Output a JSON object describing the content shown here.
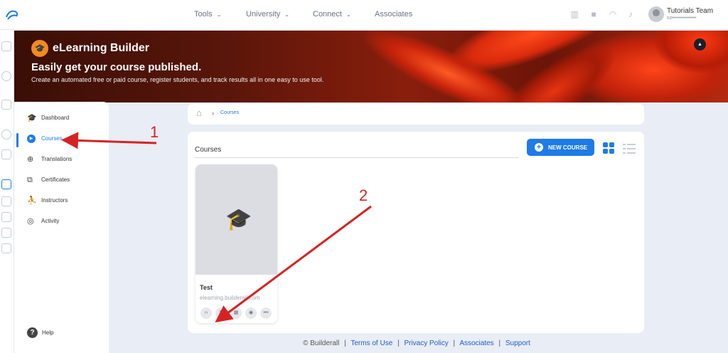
{
  "topbar": {
    "nav": [
      {
        "label": "Tools",
        "has_chevron": true
      },
      {
        "label": "University",
        "has_chevron": true
      },
      {
        "label": "Connect",
        "has_chevron": true
      },
      {
        "label": "Associates",
        "has_chevron": false
      }
    ],
    "icons": [
      "book-icon",
      "video-icon",
      "headset-icon",
      "bell-icon"
    ],
    "user": {
      "name": "Tutorials Team",
      "email_masked": "tut••••••••••••••••"
    }
  },
  "banner": {
    "brand_name": "eLearning Builder",
    "headline": "Easily get your course published.",
    "subhead": "Create an automated free or paid course, register students, and track results all in one easy to use tool."
  },
  "sidebar": {
    "items": [
      {
        "label": "Dashboard",
        "icon": "graduation-cap-icon"
      },
      {
        "label": "Courses",
        "icon": "play-circle-icon",
        "active": true
      },
      {
        "label": "Translations",
        "icon": "globe-icon"
      },
      {
        "label": "Certificates",
        "icon": "certificate-icon"
      },
      {
        "label": "Instructors",
        "icon": "people-icon"
      },
      {
        "label": "Activity",
        "icon": "activity-icon"
      }
    ],
    "help_label": "Help"
  },
  "breadcrumb": {
    "current": "Courses"
  },
  "main": {
    "title": "Courses",
    "new_course_label": "NEW COURSE",
    "courses": [
      {
        "title": "Test",
        "url": "elearning.builderall.com"
      }
    ],
    "course_actions": [
      "code-icon",
      "edit-icon",
      "stats-icon",
      "preview-icon",
      "more-icon"
    ]
  },
  "footer": {
    "copyright": "© Builderall",
    "links": [
      "Terms of Use",
      "Privacy Policy",
      "Associates",
      "Support"
    ]
  },
  "annotations": {
    "labels": [
      "1",
      "2"
    ],
    "color": "#d62222"
  },
  "colors": {
    "accent": "#1e7be8",
    "brand_orange": "#f28a1f",
    "annotation_red": "#d62222"
  }
}
